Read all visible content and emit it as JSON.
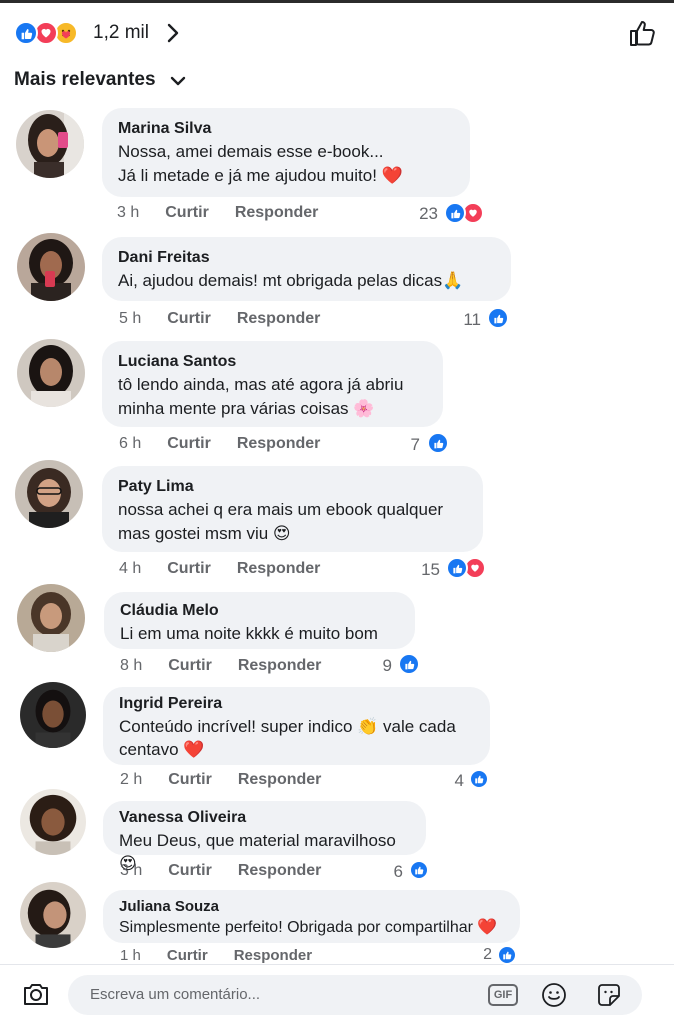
{
  "header": {
    "reaction_count": "1,2 mil",
    "reactions": [
      "like-icon",
      "love-icon",
      "care-icon"
    ]
  },
  "sort": {
    "label": "Mais relevantes"
  },
  "comments": [
    {
      "name": "Marina Silva",
      "text": "Nossa, amei demais esse e-book...\nJá li metade e já me ajudou muito! ❤️",
      "time": "3 h",
      "like": "Curtir",
      "reply": "Responder",
      "reaction_count": "23",
      "reactions": [
        "like",
        "love"
      ]
    },
    {
      "name": "Dani Freitas",
      "text": "Ai, ajudou demais! mt obrigada pelas dicas🙏",
      "time": "5 h",
      "like": "Curtir",
      "reply": "Responder",
      "reaction_count": "11",
      "reactions": [
        "like"
      ]
    },
    {
      "name": "Luciana Santos",
      "text": "tô lendo ainda, mas até agora já abriu\nminha mente pra várias coisas 🌸",
      "time": "6 h",
      "like": "Curtir",
      "reply": "Responder",
      "reaction_count": "7",
      "reactions": [
        "like"
      ]
    },
    {
      "name": "Paty Lima",
      "text": "nossa achei q era mais um ebook qualquer\nmas gostei msm viu 😍",
      "time": "4 h",
      "like": "Curtir",
      "reply": "Responder",
      "reaction_count": "15",
      "reactions": [
        "like",
        "love"
      ]
    },
    {
      "name": "Cláudia Melo",
      "text": "Li em uma noite kkkk é muito bom",
      "time": "8 h",
      "like": "Curtir",
      "reply": "Responder",
      "reaction_count": "9",
      "reactions": [
        "like"
      ]
    },
    {
      "name": "Ingrid Pereira",
      "text": "Conteúdo incrível! super indico 👏  vale cada\ncentavo ❤️",
      "time": "2 h",
      "like": "Curtir",
      "reply": "Responder",
      "reaction_count": "4",
      "reactions": [
        "like"
      ]
    },
    {
      "name": "Vanessa Oliveira",
      "text": "Meu Deus, que material maravilhoso 😍",
      "time": "3 h",
      "like": "Curtir",
      "reply": "Responder",
      "reaction_count": "6",
      "reactions": [
        "like"
      ]
    },
    {
      "name": "Juliana Souza",
      "text": "Simplesmente perfeito! Obrigada por compartilhar ❤️",
      "time": "1 h",
      "like": "Curtir",
      "reply": "Responder",
      "reaction_count": "2",
      "reactions": [
        "like"
      ]
    }
  ],
  "composer": {
    "placeholder": "Escreva um comentário...",
    "gif_label": "GIF"
  },
  "colors": {
    "like": "#1877f2",
    "love": "#f33e58",
    "bubble": "#f0f2f5",
    "meta": "#65676b"
  }
}
